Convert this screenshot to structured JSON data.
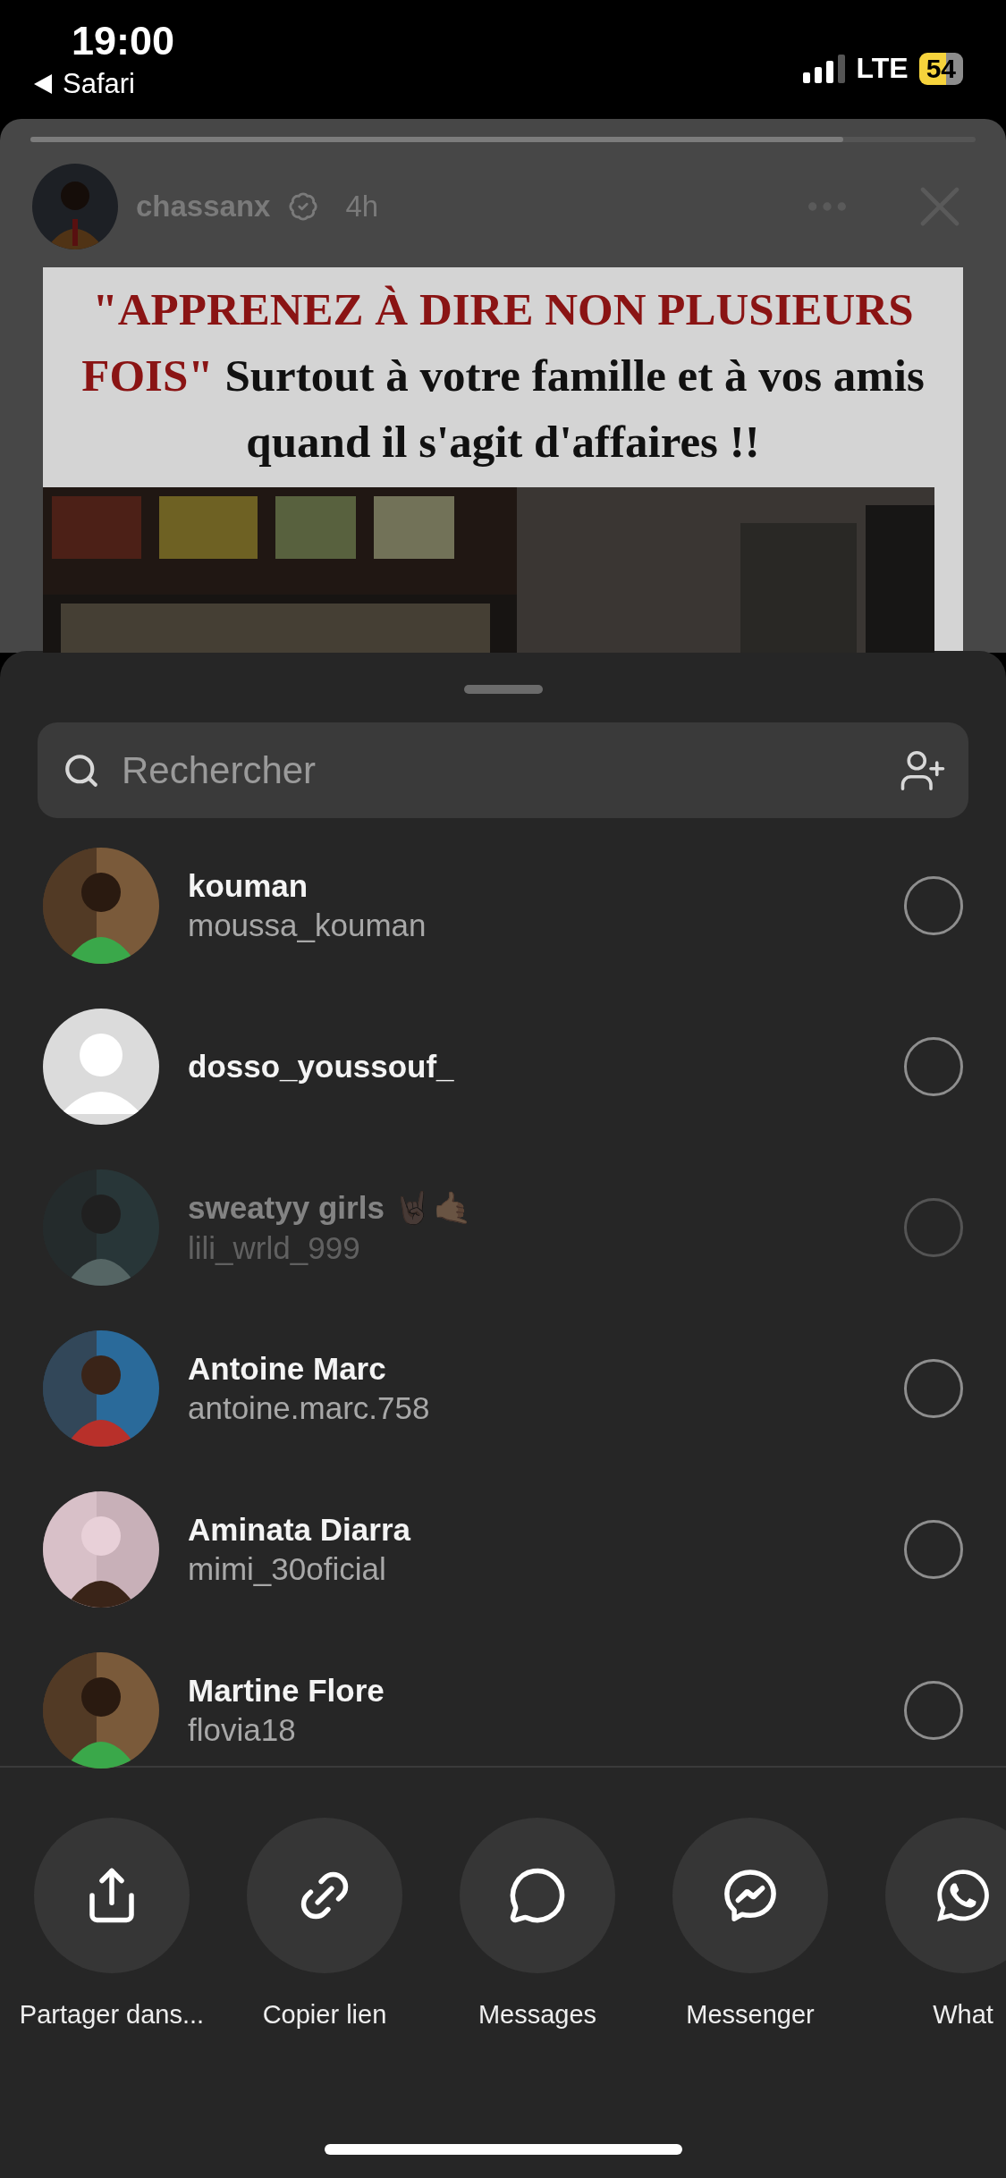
{
  "status_bar": {
    "time": "19:00",
    "back_label": "Safari",
    "network": "LTE",
    "battery": "54",
    "low_power": true
  },
  "story": {
    "progress": {
      "level": 0.86
    },
    "username": "chassanx",
    "verified": true,
    "time": "4h",
    "headline": {
      "highlight": "\"APPRENEZ À DIRE NON PLUSIEURS FOIS\"",
      "text": "Surtout à votre famille et à vos amis quand il s'agit d'affaires !!"
    }
  },
  "share_sheet": {
    "search": {
      "placeholder": "Rechercher"
    },
    "contacts": [
      {
        "name": "kouman",
        "username": "moussa_kouman",
        "disabled": false,
        "selected": false
      },
      {
        "name": "dosso_youssouf_",
        "kind": "default",
        "disabled": false,
        "selected": false
      },
      {
        "name": "sweatyy girls 🤘🏿🤙🏽",
        "username": "lili_wrld_999",
        "disabled": true,
        "selected": false
      },
      {
        "name": "Antoine Marc",
        "username": "antoine.marc.758",
        "disabled": false,
        "selected": false
      },
      {
        "name": "Aminata Diarra",
        "username": "mimi_30oficial",
        "disabled": false,
        "selected": false
      },
      {
        "name": "Martine Flore",
        "username": "flovia18",
        "disabled": false,
        "selected": false
      }
    ],
    "targets": [
      {
        "kind": "share",
        "label": "Partager dans..."
      },
      {
        "kind": "link",
        "label": "Copier lien"
      },
      {
        "kind": "messages",
        "label": "Messages"
      },
      {
        "kind": "messenger",
        "label": "Messenger"
      },
      {
        "kind": "whatsapp",
        "label": "What"
      }
    ]
  }
}
